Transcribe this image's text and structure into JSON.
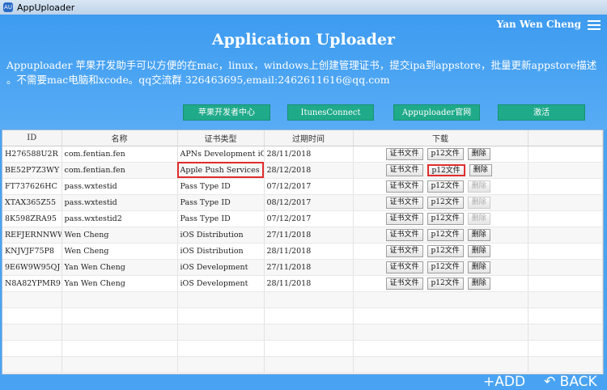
{
  "window": {
    "title": "AppUploader",
    "icon_text": "AU"
  },
  "header": {
    "user": "Yan Wen Cheng",
    "title": "Application Uploader",
    "description": "Appuploader 苹果开发助手可以方便的在mac，linux，windows上创建管理证书，提交ipa到appstore，批量更新appstore描述 。不需要mac电脑和xcode。qq交流群 326463695,email:2462611616@qq.com"
  },
  "nav": [
    "苹果开发者中心",
    "ItunesConnect",
    "Appuploader官网",
    "激活"
  ],
  "table": {
    "columns": [
      "ID",
      "名称",
      "证书类型",
      "过期时间",
      "下载"
    ],
    "buttons": {
      "cert": "证书文件",
      "p12": "p12文件",
      "delete": "删除"
    },
    "rows": [
      {
        "id": "H276588U2R",
        "name": "com.fentian.fen",
        "type": "APNs Development iOS",
        "expires": "28/11/2018"
      },
      {
        "id": "BE52P7Z3WY",
        "name": "com.fentian.fen",
        "type": "Apple Push Services",
        "expires": "28/12/2018"
      },
      {
        "id": "FT737626HC",
        "name": "pass.wxtestid",
        "type": "Pass Type ID",
        "expires": "07/12/2017"
      },
      {
        "id": "XTAX365Z55",
        "name": "pass.wxtestid",
        "type": "Pass Type ID",
        "expires": "08/12/2017"
      },
      {
        "id": "8K598ZRA95",
        "name": "pass.wxtestid2",
        "type": "Pass Type ID",
        "expires": "07/12/2017"
      },
      {
        "id": "REFJERNNWW",
        "name": "Wen Cheng",
        "type": "iOS Distribution",
        "expires": "27/11/2018"
      },
      {
        "id": "KNJVJF75P8",
        "name": "Wen Cheng",
        "type": "iOS Distribution",
        "expires": "28/11/2018"
      },
      {
        "id": "9E6W9W95QJ",
        "name": "Yan Wen Cheng",
        "type": "iOS Development",
        "expires": "27/11/2018"
      },
      {
        "id": "N8A82YPMR9",
        "name": "Yan Wen Cheng",
        "type": "iOS Development",
        "expires": "28/11/2018"
      }
    ]
  },
  "footer": {
    "add": "+ADD",
    "back": "BACK"
  }
}
